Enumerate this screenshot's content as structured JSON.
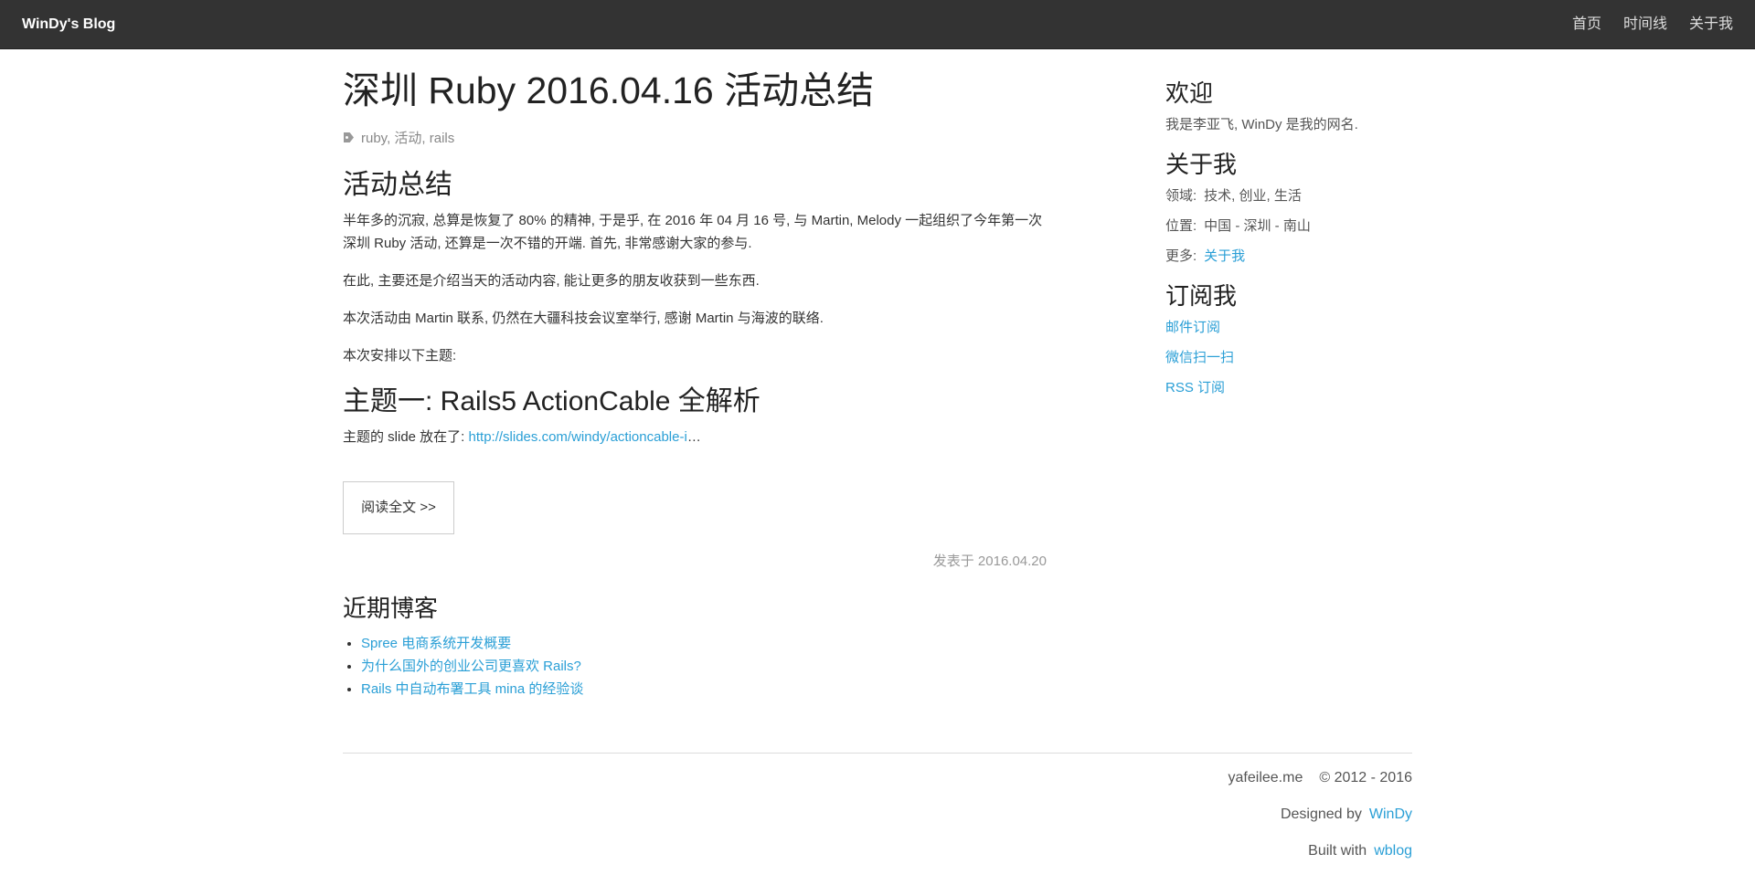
{
  "nav": {
    "brand": "WinDy's Blog",
    "links": [
      "首页",
      "时间线",
      "关于我"
    ]
  },
  "post": {
    "title": "深圳 Ruby 2016.04.16 活动总结",
    "tags": "ruby, 活动, rails",
    "section1_title": "活动总结",
    "p1": "半年多的沉寂, 总算是恢复了 80% 的精神, 于是乎, 在 2016 年 04 月 16 号, 与 Martin, Melody 一起组织了今年第一次深圳 Ruby 活动, 还算是一次不错的开端. 首先, 非常感谢大家的参与.",
    "p2": "在此, 主要还是介绍当天的活动内容, 能让更多的朋友收获到一些东西.",
    "p3": "本次活动由 Martin 联系, 仍然在大疆科技会议室举行, 感谢 Martin 与海波的联络.",
    "p4": "本次安排以下主题:",
    "section2_title": "主题一: Rails5 ActionCable 全解析",
    "slide_prefix": "主题的 slide 放在了: ",
    "slide_link": "http://slides.com/windy/actioncable-i",
    "slide_ellipsis": "…",
    "read_more": "阅读全文 >>",
    "published": "发表于 2016.04.20"
  },
  "recent": {
    "title": "近期博客",
    "items": [
      "Spree 电商系统开发概要",
      "为什么国外的创业公司更喜欢 Rails?",
      "Rails 中自动布署工具 mina 的经验谈"
    ]
  },
  "sidebar": {
    "welcome_title": "欢迎",
    "welcome_text": "我是李亚飞, WinDy 是我的网名.",
    "about_title": "关于我",
    "field_label": "领域:",
    "field_value": "技术, 创业, 生活",
    "location_label": "位置:",
    "location_value": "中国 - 深圳 - 南山",
    "more_label": "更多:",
    "more_link": "关于我",
    "subscribe_title": "订阅我",
    "subscribe_links": [
      "邮件订阅",
      "微信扫一扫",
      "RSS 订阅"
    ]
  },
  "footer": {
    "site": "yafeilee.me",
    "copyright": "© 2012 - 2016",
    "designed_by": "Designed by",
    "designer": "WinDy",
    "built_with": "Built with",
    "engine": "wblog"
  },
  "colors": {
    "navbar_bg": "#333333",
    "link": "#2a9fd6",
    "text": "#333333",
    "muted": "#999999"
  },
  "icons": [
    "tag-icon"
  ]
}
